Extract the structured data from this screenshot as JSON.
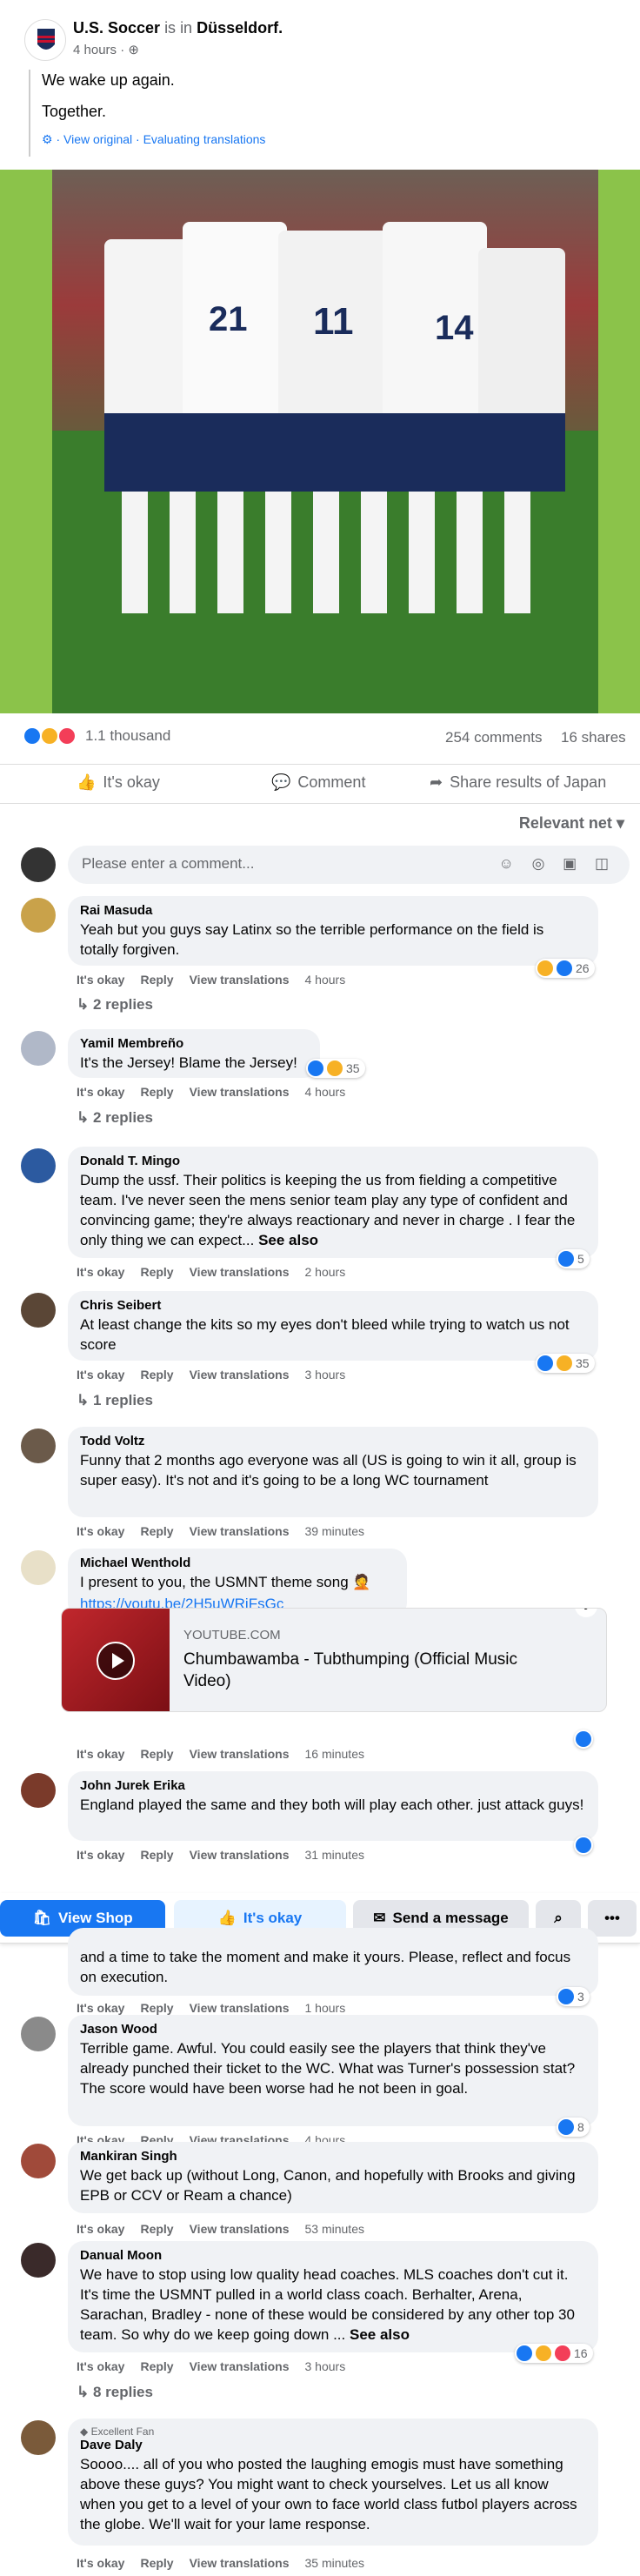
{
  "post": {
    "author": "U.S. Soccer",
    "is_in": "is in",
    "location": "Düsseldorf.",
    "time": "4 hours ·",
    "line1": "We wake up again.",
    "line2": "Together.",
    "translate": "· View original · Evaluating translations"
  },
  "stats": {
    "reactions": "1.1 thousand",
    "comments": "254 comments",
    "shares": "16 shares"
  },
  "actions": {
    "like": "It's okay",
    "comment": "Comment",
    "share": "Share results of Japan"
  },
  "sort": "Relevant net",
  "comment_placeholder": "Please enter a comment...",
  "comments": [
    {
      "name": "Rai Masuda",
      "text": "Yeah but you guys say Latinx so the terrible performance on the field is totally forgiven.",
      "time": "4 hours",
      "count": "26",
      "replies": "2 replies"
    },
    {
      "name": "Yamil Membreño",
      "text": "It's the Jersey! Blame the Jersey!",
      "time": "4 hours",
      "count": "35",
      "replies": "2 replies"
    },
    {
      "name": "Donald T. Mingo",
      "text": "Dump the ussf. Their politics is keeping the us from fielding a competitive team. I've never seen the mens senior team play any type of confident and convincing game; they're always reactionary and never in charge . I fear the only thing we can expect...",
      "see_more": "See also",
      "time": "2 hours",
      "count": "5"
    },
    {
      "name": "Chris Seibert",
      "text": "At least change the kits so my eyes don't bleed while trying to watch us not score",
      "time": "3 hours",
      "count": "35",
      "replies": "1 replies"
    },
    {
      "name": "Todd Voltz",
      "text": "Funny that 2 months ago everyone was all (US is going to win it all, group is super easy). It's not and it's going to be a long WC tournament",
      "time": "39 minutes"
    },
    {
      "name": "Michael Wenthold",
      "text": "I present to you, the USMNT theme song 🤦",
      "link": "https://youtu.be/2H5uWRjFsGc",
      "time": "16 minutes"
    },
    {
      "name": "John Jurek Erika",
      "text": "England played the same and they both will play each other. just attack guys!",
      "time": "31 minutes"
    },
    {
      "name": "",
      "text": "and a time to take the moment and make it yours. Please, reflect and focus on execution.",
      "time": "1 hours",
      "count": "3"
    },
    {
      "name": "Jason Wood",
      "text": "Terrible game. Awful. You could easily see the players that think they've already punched their ticket to the WC. What was Turner's possession stat? The score would have been worse had he not been in goal.",
      "time": "4 hours",
      "count": "8"
    },
    {
      "name": "Mankiran Singh",
      "text": "We get back up (without Long, Canon, and hopefully with Brooks and giving EPB or CCV or Ream a chance)",
      "time": "53 minutes"
    },
    {
      "name": "Danual Moon",
      "text": "We have to stop using low quality head coaches. MLS coaches don't cut it. It's time the USMNT pulled in a world class coach. Berhalter, Arena, Sarachan, Bradley - none of these would be considered by any other top 30 team. So why do we keep going down ...",
      "see_more": "See also",
      "time": "3 hours",
      "count": "16",
      "replies": "8 replies"
    },
    {
      "name": "Dave Daly",
      "badge": "Excellent Fan",
      "text": "Soooo.... all of you who posted the laughing emogis must have something above these guys? You might want to check yourselves. Let us all know when you get to a level of your own to face world class futbol players across the globe. We'll wait for your lame response.",
      "time": "35 minutes"
    }
  ],
  "labels": {
    "like": "It's okay",
    "reply": "Reply",
    "translate": "View translations"
  },
  "link_card": {
    "domain": "YOUTUBE.COM",
    "title": "Chumbawamba - Tubthumping (Official Music Video)"
  },
  "bottom_bar": {
    "shop": "View Shop",
    "like": "It's okay",
    "message": "Send a message"
  },
  "colors": {
    "accent": "#1877f2",
    "photo_border": "#8bc34a"
  }
}
